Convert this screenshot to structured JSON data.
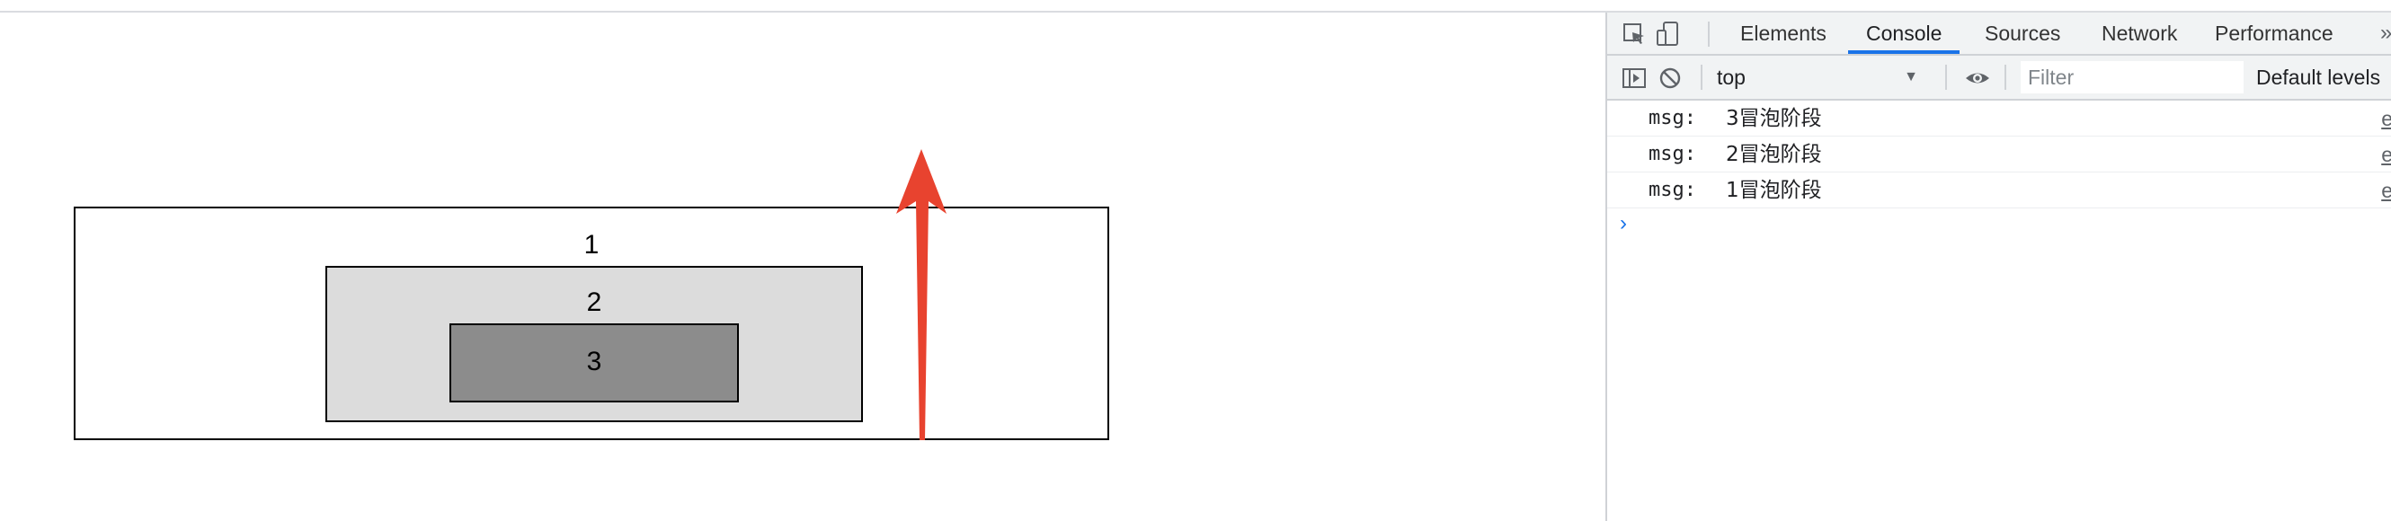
{
  "page": {
    "boxes": [
      {
        "label": "1"
      },
      {
        "label": "2"
      },
      {
        "label": "3"
      }
    ],
    "arrow_color": "#e8432f"
  },
  "devtools": {
    "toolbar_icons": [
      "inspect-element-icon",
      "device-toggle-icon"
    ],
    "tabs": [
      {
        "label": "Elements",
        "active": false
      },
      {
        "label": "Console",
        "active": true
      },
      {
        "label": "Sources",
        "active": false
      },
      {
        "label": "Network",
        "active": false
      },
      {
        "label": "Performance",
        "active": false
      }
    ],
    "more_tabs": "»",
    "console_toolbar": {
      "context": "top",
      "filter_placeholder": "Filter",
      "levels": "Default levels"
    },
    "logs": [
      {
        "key": "msg:",
        "message": "3冒泡阶段",
        "source": "e"
      },
      {
        "key": "msg:",
        "message": "2冒泡阶段",
        "source": "e"
      },
      {
        "key": "msg:",
        "message": "1冒泡阶段",
        "source": "e"
      }
    ],
    "prompt": "›",
    "accent_color": "#1a73e8"
  }
}
